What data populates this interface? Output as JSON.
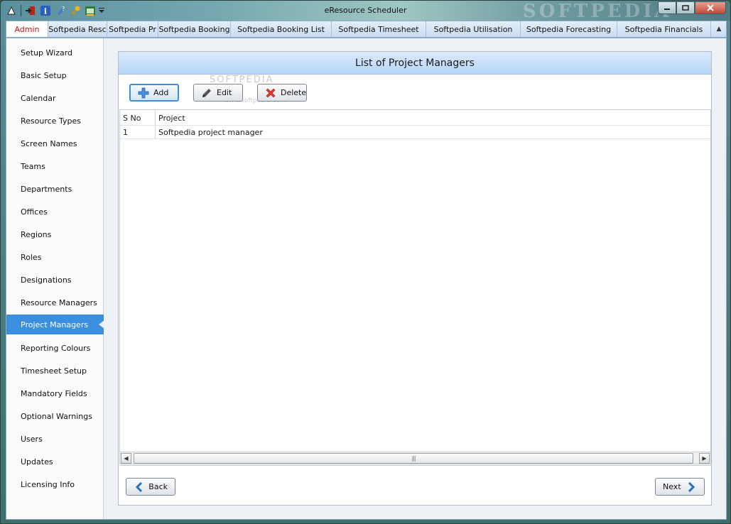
{
  "window": {
    "title": "eResource Scheduler",
    "watermark": "SOFTPEDIA"
  },
  "qat": {
    "icons": [
      "scheduler-icon",
      "exit-icon",
      "info-icon",
      "help-icon",
      "key-icon",
      "calendar-icon",
      "customize-dropdown-icon"
    ]
  },
  "tabs": [
    {
      "label": "Admin",
      "active": true
    },
    {
      "label": "Softpedia Resc"
    },
    {
      "label": "Softpedia Pr"
    },
    {
      "label": "Softpedia Booking"
    },
    {
      "label": "Softpedia Booking List"
    },
    {
      "label": "Softpedia Timesheet"
    },
    {
      "label": "Softpedia Utilisation"
    },
    {
      "label": "Softpedia Forecasting"
    },
    {
      "label": "Softpedia Financials"
    }
  ],
  "sidebar": {
    "items": [
      {
        "label": "Setup Wizard"
      },
      {
        "label": "Basic Setup"
      },
      {
        "label": "Calendar"
      },
      {
        "label": "Resource Types"
      },
      {
        "label": "Screen Names"
      },
      {
        "label": "Teams"
      },
      {
        "label": "Departments"
      },
      {
        "label": "Offices"
      },
      {
        "label": "Regions"
      },
      {
        "label": "Roles"
      },
      {
        "label": "Designations"
      },
      {
        "label": "Resource Managers"
      },
      {
        "label": "Project Managers",
        "selected": true
      },
      {
        "label": "Reporting Colours"
      },
      {
        "label": "Timesheet Setup"
      },
      {
        "label": "Mandatory Fields"
      },
      {
        "label": "Optional Warnings"
      },
      {
        "label": "Users"
      },
      {
        "label": "Updates"
      },
      {
        "label": "Licensing Info"
      }
    ]
  },
  "panel": {
    "title": "List of Project Managers",
    "toolbar": {
      "add_label": "Add",
      "edit_label": "Edit",
      "delete_label": "Delete"
    },
    "watermark": "SOFTPEDIA",
    "watermark_sub": "www.softpedia.com",
    "grid": {
      "columns": [
        "S No",
        "Project"
      ],
      "rows": [
        [
          "1",
          "Softpedia project manager"
        ]
      ]
    },
    "footer": {
      "back_label": "Back",
      "next_label": "Next"
    }
  },
  "colors": {
    "accent": "#3c8fdf",
    "active_tab_text": "#d01010",
    "header_bg": "#b7d6f7"
  }
}
